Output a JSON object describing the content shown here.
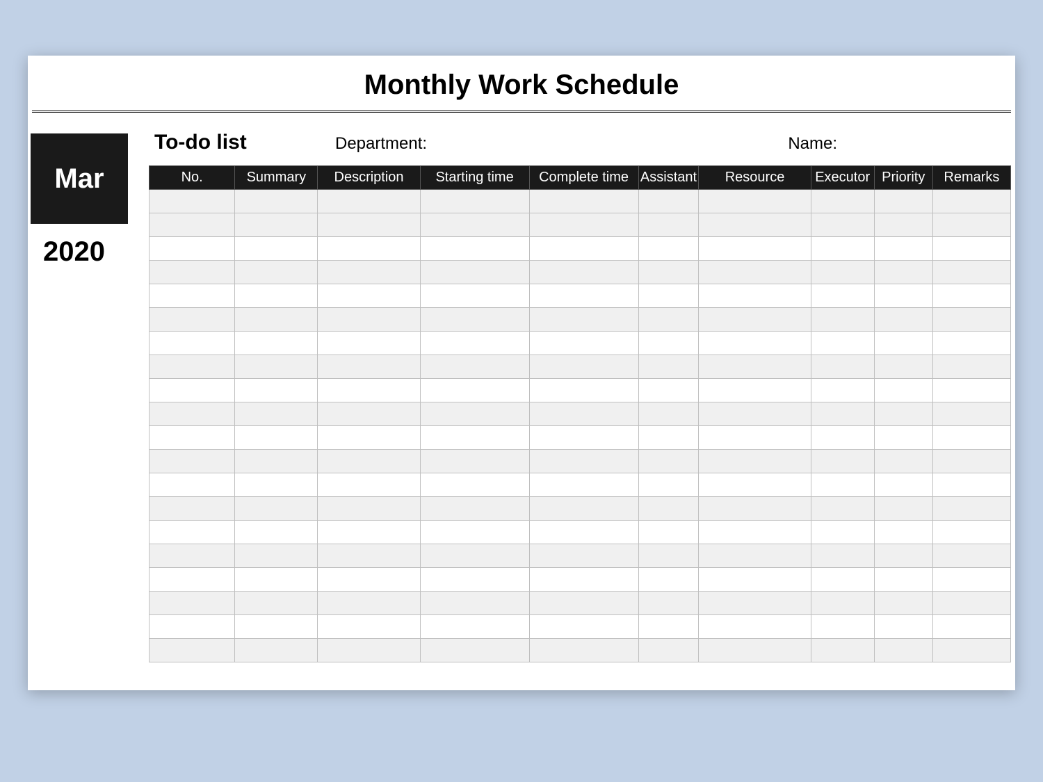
{
  "title": "Monthly Work Schedule",
  "side": {
    "month": "Mar",
    "year": "2020"
  },
  "info": {
    "todo_label": "To-do list",
    "department_label": "Department:",
    "name_label": "Name:"
  },
  "table": {
    "headers": [
      "No.",
      "Summary",
      "Description",
      "Starting time",
      "Complete time",
      "Assistant",
      "Resource",
      "Executor",
      "Priority",
      "Remarks"
    ],
    "row_count": 20
  }
}
